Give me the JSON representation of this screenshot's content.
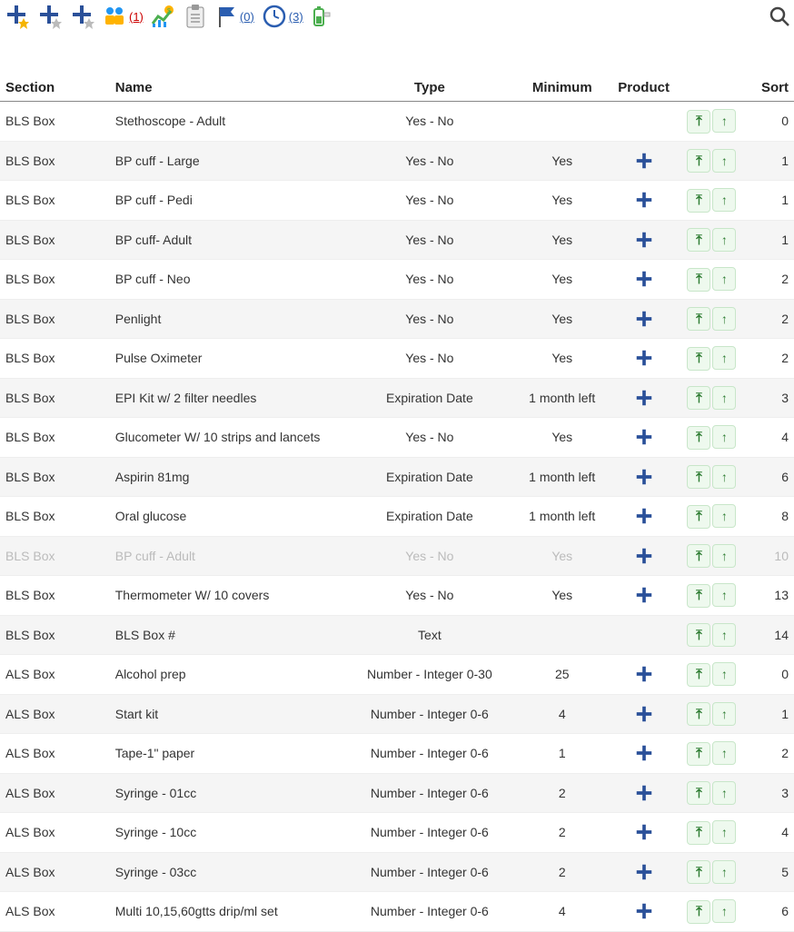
{
  "toolbar": {
    "people_count": "(1)",
    "flag_count": "(0)",
    "clock_count": "(3)"
  },
  "headers": {
    "section": "Section",
    "name": "Name",
    "type": "Type",
    "minimum": "Minimum",
    "product": "Product",
    "sort": "Sort"
  },
  "rows": [
    {
      "section": "BLS Box",
      "name": "Stethoscope - Adult",
      "type": "Yes - No",
      "min": "",
      "product": false,
      "sort": "0",
      "disabled": false
    },
    {
      "section": "BLS Box",
      "name": "BP cuff - Large",
      "type": "Yes - No",
      "min": "Yes",
      "product": true,
      "sort": "1",
      "disabled": false
    },
    {
      "section": "BLS Box",
      "name": "BP cuff - Pedi",
      "type": "Yes - No",
      "min": "Yes",
      "product": true,
      "sort": "1",
      "disabled": false
    },
    {
      "section": "BLS Box",
      "name": "BP cuff- Adult",
      "type": "Yes - No",
      "min": "Yes",
      "product": true,
      "sort": "1",
      "disabled": false
    },
    {
      "section": "BLS Box",
      "name": "BP cuff - Neo",
      "type": "Yes - No",
      "min": "Yes",
      "product": true,
      "sort": "2",
      "disabled": false
    },
    {
      "section": "BLS Box",
      "name": "Penlight",
      "type": "Yes - No",
      "min": "Yes",
      "product": true,
      "sort": "2",
      "disabled": false
    },
    {
      "section": "BLS Box",
      "name": "Pulse Oximeter",
      "type": "Yes - No",
      "min": "Yes",
      "product": true,
      "sort": "2",
      "disabled": false
    },
    {
      "section": "BLS Box",
      "name": "EPI Kit w/ 2 filter needles",
      "type": "Expiration Date",
      "min": "1 month left",
      "product": true,
      "sort": "3",
      "disabled": false
    },
    {
      "section": "BLS Box",
      "name": "Glucometer W/ 10 strips and lancets",
      "type": "Yes - No",
      "min": "Yes",
      "product": true,
      "sort": "4",
      "disabled": false
    },
    {
      "section": "BLS Box",
      "name": "Aspirin 81mg",
      "type": "Expiration Date",
      "min": "1 month left",
      "product": true,
      "sort": "6",
      "disabled": false
    },
    {
      "section": "BLS Box",
      "name": "Oral glucose",
      "type": "Expiration Date",
      "min": "1 month left",
      "product": true,
      "sort": "8",
      "disabled": false
    },
    {
      "section": "BLS Box",
      "name": "BP cuff - Adult",
      "type": "Yes - No",
      "min": "Yes",
      "product": true,
      "sort": "10",
      "disabled": true
    },
    {
      "section": "BLS Box",
      "name": "Thermometer W/ 10 covers",
      "type": "Yes - No",
      "min": "Yes",
      "product": true,
      "sort": "13",
      "disabled": false
    },
    {
      "section": "BLS Box",
      "name": "BLS Box #",
      "type": "Text",
      "min": "",
      "product": false,
      "sort": "14",
      "disabled": false
    },
    {
      "section": "ALS Box",
      "name": "Alcohol prep",
      "type": "Number - Integer 0-30",
      "min": "25",
      "product": true,
      "sort": "0",
      "disabled": false
    },
    {
      "section": "ALS Box",
      "name": "Start kit",
      "type": "Number - Integer 0-6",
      "min": "4",
      "product": true,
      "sort": "1",
      "disabled": false
    },
    {
      "section": "ALS Box",
      "name": "Tape-1\" paper",
      "type": "Number - Integer 0-6",
      "min": "1",
      "product": true,
      "sort": "2",
      "disabled": false
    },
    {
      "section": "ALS Box",
      "name": "Syringe - 01cc",
      "type": "Number - Integer 0-6",
      "min": "2",
      "product": true,
      "sort": "3",
      "disabled": false
    },
    {
      "section": "ALS Box",
      "name": "Syringe - 10cc",
      "type": "Number - Integer 0-6",
      "min": "2",
      "product": true,
      "sort": "4",
      "disabled": false
    },
    {
      "section": "ALS Box",
      "name": "Syringe - 03cc",
      "type": "Number - Integer 0-6",
      "min": "2",
      "product": true,
      "sort": "5",
      "disabled": false
    },
    {
      "section": "ALS Box",
      "name": "Multi 10,15,60gtts drip/ml set",
      "type": "Number - Integer 0-6",
      "min": "4",
      "product": true,
      "sort": "6",
      "disabled": false
    }
  ]
}
